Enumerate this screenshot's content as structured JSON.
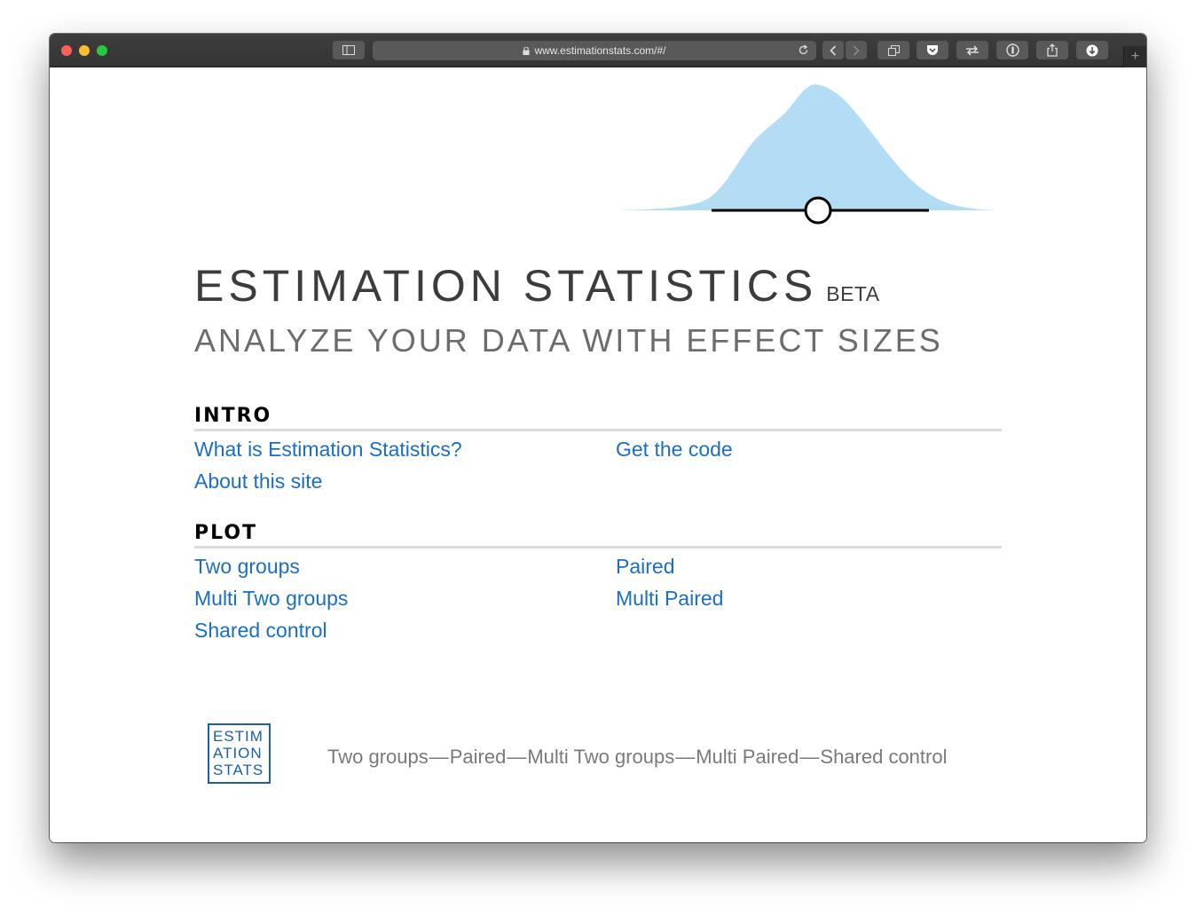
{
  "browser": {
    "url": "www.estimationstats.com/#/",
    "new_tab_label": "+"
  },
  "hero": {
    "title": "ESTIMATION STATISTICS",
    "badge": "BETA",
    "subtitle": "ANALYZE YOUR DATA WITH EFFECT SIZES",
    "curve_color": "#b3dcf5"
  },
  "intro": {
    "heading": "INTRO",
    "links": [
      "What is Estimation Statistics?",
      "Get the code",
      "About this site"
    ]
  },
  "plot": {
    "heading": "PLOT",
    "links": [
      "Two groups",
      "Paired",
      "Multi Two groups",
      "Multi Paired",
      "Shared control"
    ]
  },
  "footer": {
    "logo_lines": [
      "ESTIM",
      "ATION",
      "STATS"
    ],
    "nav": [
      "Two groups",
      "Paired",
      "Multi Two groups",
      "Multi Paired",
      "Shared control"
    ],
    "separator": "—"
  },
  "colors": {
    "link": "#1b6ec2",
    "logo": "#1b5fa8"
  }
}
